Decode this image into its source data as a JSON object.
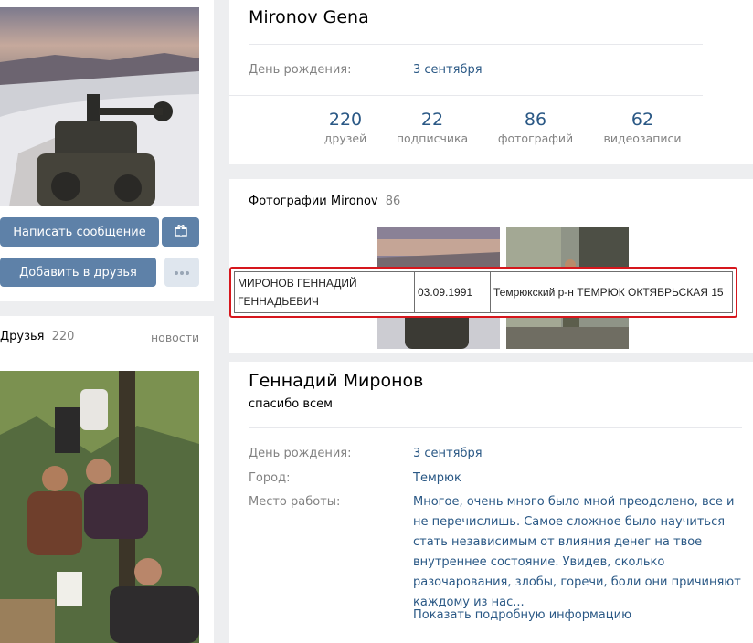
{
  "left": {
    "avatar_alt": "",
    "buttons": {
      "message": "Написать сообщение",
      "gift_icon": "gift-icon",
      "add_friend": "Добавить в друзья",
      "more_icon": "more-dots-icon"
    },
    "friends": {
      "label": "Друзья",
      "count": "220",
      "news": "новости"
    }
  },
  "profile_top": {
    "name": "Mironov Gena",
    "birthday_label": "День рождения:",
    "birthday_value": "3 сентября",
    "counters": [
      {
        "num": "220",
        "label": "друзей"
      },
      {
        "num": "22",
        "label": "подписчика"
      },
      {
        "num": "86",
        "label": "фотографий"
      },
      {
        "num": "62",
        "label": "видеозаписи"
      }
    ]
  },
  "photos": {
    "title": "Фотографии Mironov",
    "count": "86"
  },
  "record": {
    "name": "МИРОНОВ ГЕННАДИЙ ГЕННАДЬЕВИЧ",
    "date": "03.09.1991",
    "address": "Темрюкский р-н ТЕМРЮК ОКТЯБРЬСКАЯ 15"
  },
  "profile_bottom": {
    "name": "Геннадий Миронов",
    "status": "спасибо всем",
    "birthday_label": "День рождения:",
    "birthday_value": "3 сентября",
    "city_label": "Город:",
    "city_value": "Темрюк",
    "work_label": "Место работы:",
    "work_value": "Многое, очень много было мной преодолено, все и не перечислишь. Самое сложное было научиться стать независимым от влияния денег на твое внутреннее состояние. Увидев, сколько разочарования, злобы, горечи, боли они причиняют каждому из нас...",
    "more_link": "Показать подробную информацию"
  },
  "colors": {
    "link": "#2a5885",
    "button": "#5e81a8",
    "highlight_border": "#d6171d",
    "background": "#edeef0"
  }
}
